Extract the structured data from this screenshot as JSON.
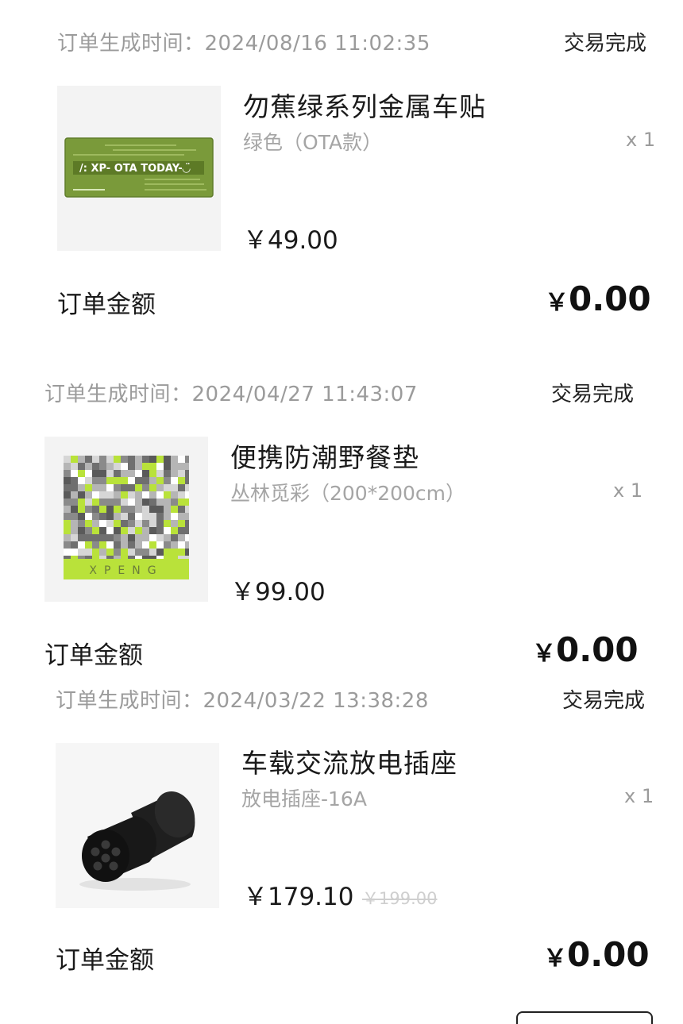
{
  "orders": [
    {
      "created_label": "订单生成时间：2024/08/16 11:02:35",
      "status": "交易完成",
      "product": {
        "title": "勿蕉绿系列金属车贴",
        "variant": "绿色（OTA款）",
        "qty": "x 1",
        "price": "￥49.00",
        "sticker_text": "/: XP- OTA TODAY-◡̈"
      },
      "total_label": "订单金额",
      "total_currency": "￥",
      "total_value": "0.00"
    },
    {
      "created_label": "订单生成时间：2024/04/27 11:43:07",
      "status": "交易完成",
      "product": {
        "title": "便携防潮野餐垫",
        "variant": "丛林觅彩（200*200cm）",
        "qty": "x 1",
        "price": "￥99.00",
        "mat_brand": "XPENG"
      },
      "total_label": "订单金额",
      "total_currency": "￥",
      "total_value": "0.00"
    },
    {
      "created_label": "订单生成时间：2024/03/22 13:38:28",
      "status": "交易完成",
      "product": {
        "title": "车载交流放电插座",
        "variant": "放电插座-16A",
        "qty": "x 1",
        "price": "￥179.10",
        "original_price": "￥199.00"
      },
      "total_label": "订单金额",
      "total_currency": "￥",
      "total_value": "0.00"
    }
  ],
  "colors": {
    "sticker_green": "#7a9a3a",
    "lime": "#b9e23a",
    "text_dark": "#1a1a1a",
    "text_muted": "#9b9b9b"
  }
}
